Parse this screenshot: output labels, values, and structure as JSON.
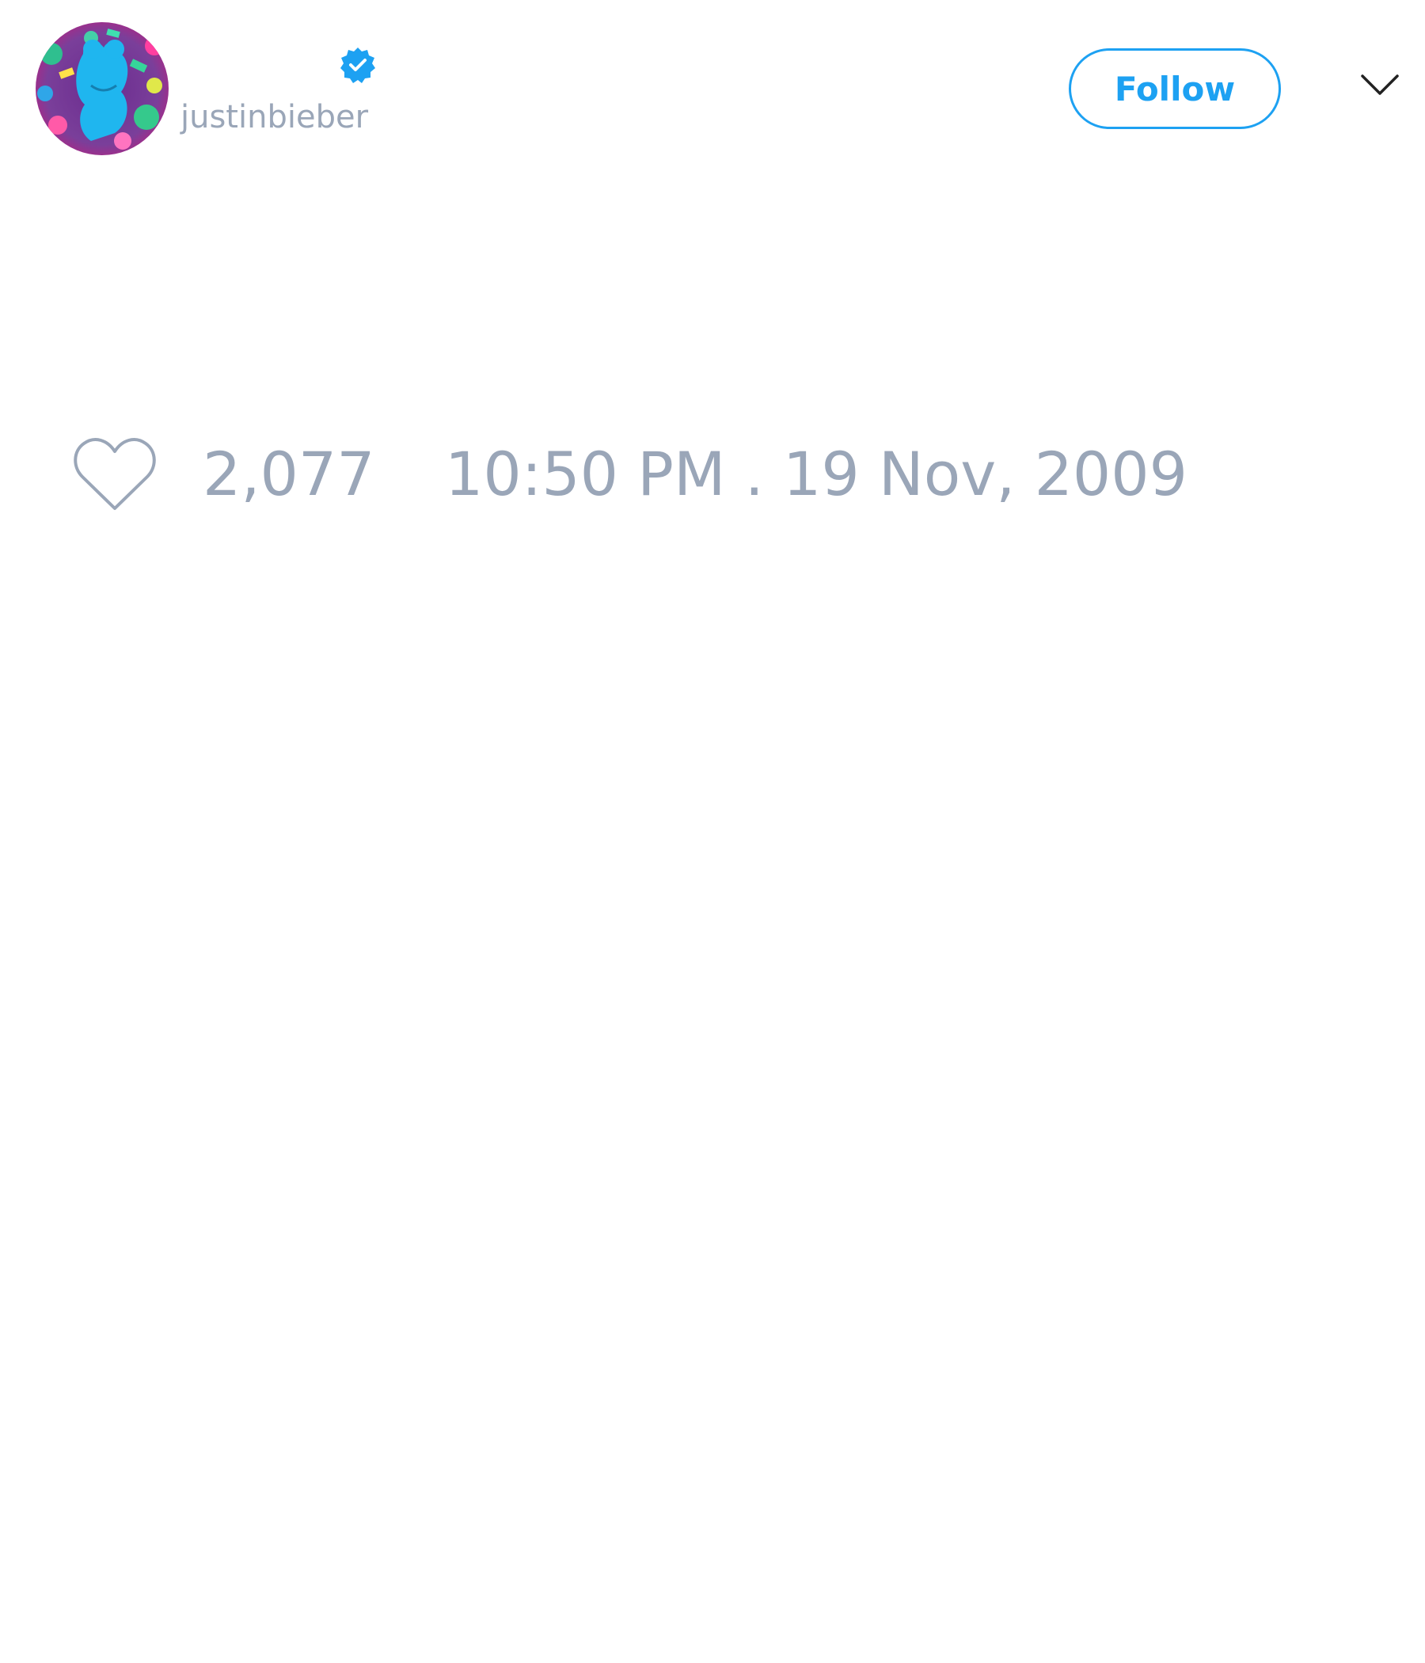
{
  "author": {
    "handle": "justinbieber",
    "verified": true,
    "avatar_icon": "avatar-image"
  },
  "header": {
    "follow_label": "Follow",
    "menu_icon": "chevron-down-icon"
  },
  "stats": {
    "like_icon": "heart-icon",
    "like_count": "2,077",
    "timestamp": "10:50 PM . 19 Nov, 2009"
  },
  "colors": {
    "accent": "#1da1f2",
    "muted_text": "#9aa6b8",
    "background": "#ffffff"
  }
}
